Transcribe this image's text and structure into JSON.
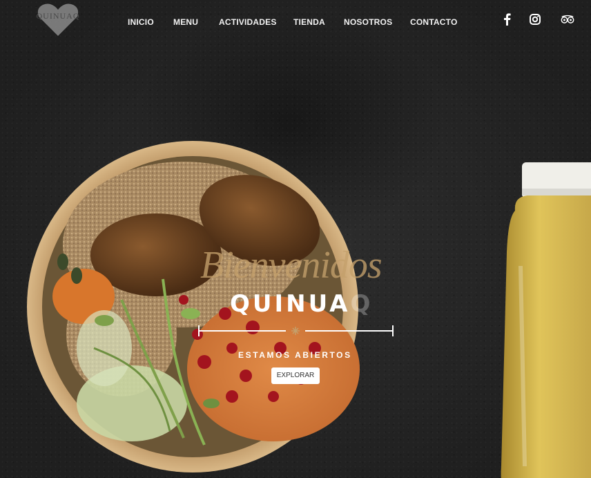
{
  "brand": {
    "logo_text": "QUINUAQ"
  },
  "nav": {
    "items": [
      {
        "label": "INICIO"
      },
      {
        "label": "MENU"
      },
      {
        "label": "ACTIVIDADES"
      },
      {
        "label": "TIENDA"
      },
      {
        "label": "NOSOTROS"
      },
      {
        "label": "CONTACTO"
      }
    ]
  },
  "social": {
    "icons": [
      "facebook-icon",
      "instagram-icon",
      "tripadvisor-icon"
    ]
  },
  "hero": {
    "script_text": "Bienvenidos",
    "title_main": "QUINUA",
    "title_tail": "Q",
    "subtitle": "ESTAMOS ABIERTOS",
    "button_label": "EXPLORAR"
  },
  "colors": {
    "background": "#252525",
    "script_gold": "#c4a06c",
    "text_white": "#ffffff",
    "bowl_kraft": "#c9a275"
  }
}
